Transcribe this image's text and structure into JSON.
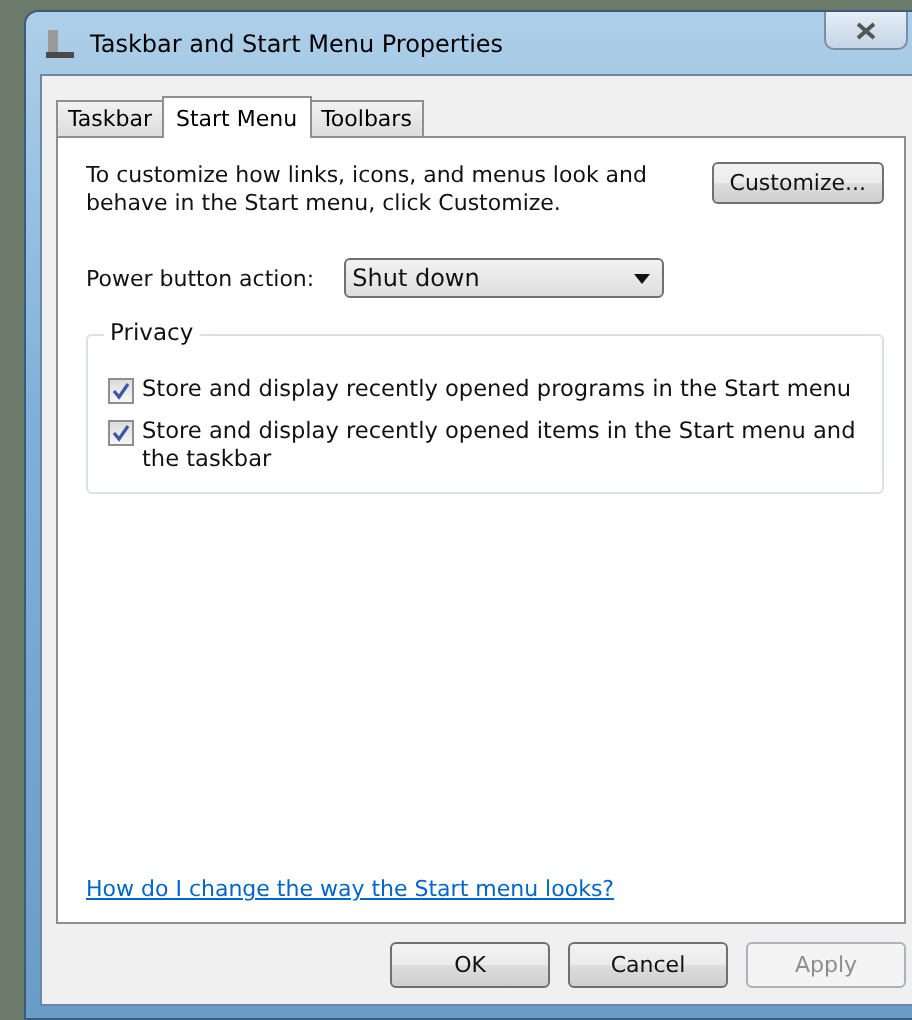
{
  "window": {
    "title": "Taskbar and Start Menu Properties"
  },
  "tabs": [
    {
      "label": "Taskbar",
      "selected": false
    },
    {
      "label": "Start Menu",
      "selected": true
    },
    {
      "label": "Toolbars",
      "selected": false
    }
  ],
  "intro": "To customize how links, icons, and menus look and behave in the Start menu, click Customize.",
  "customize_button": "Customize...",
  "power_button": {
    "label": "Power button action:",
    "value": "Shut down"
  },
  "privacy": {
    "title": "Privacy",
    "options": [
      {
        "label": "Store and display recently opened programs in the Start menu",
        "checked": true
      },
      {
        "label": "Store and display recently opened items in the Start menu and the taskbar",
        "checked": true
      }
    ]
  },
  "help_link": "How do I change the way the Start menu looks?",
  "buttons": [
    {
      "label": "OK",
      "disabled": false
    },
    {
      "label": "Cancel",
      "disabled": false
    },
    {
      "label": "Apply",
      "disabled": true
    }
  ]
}
